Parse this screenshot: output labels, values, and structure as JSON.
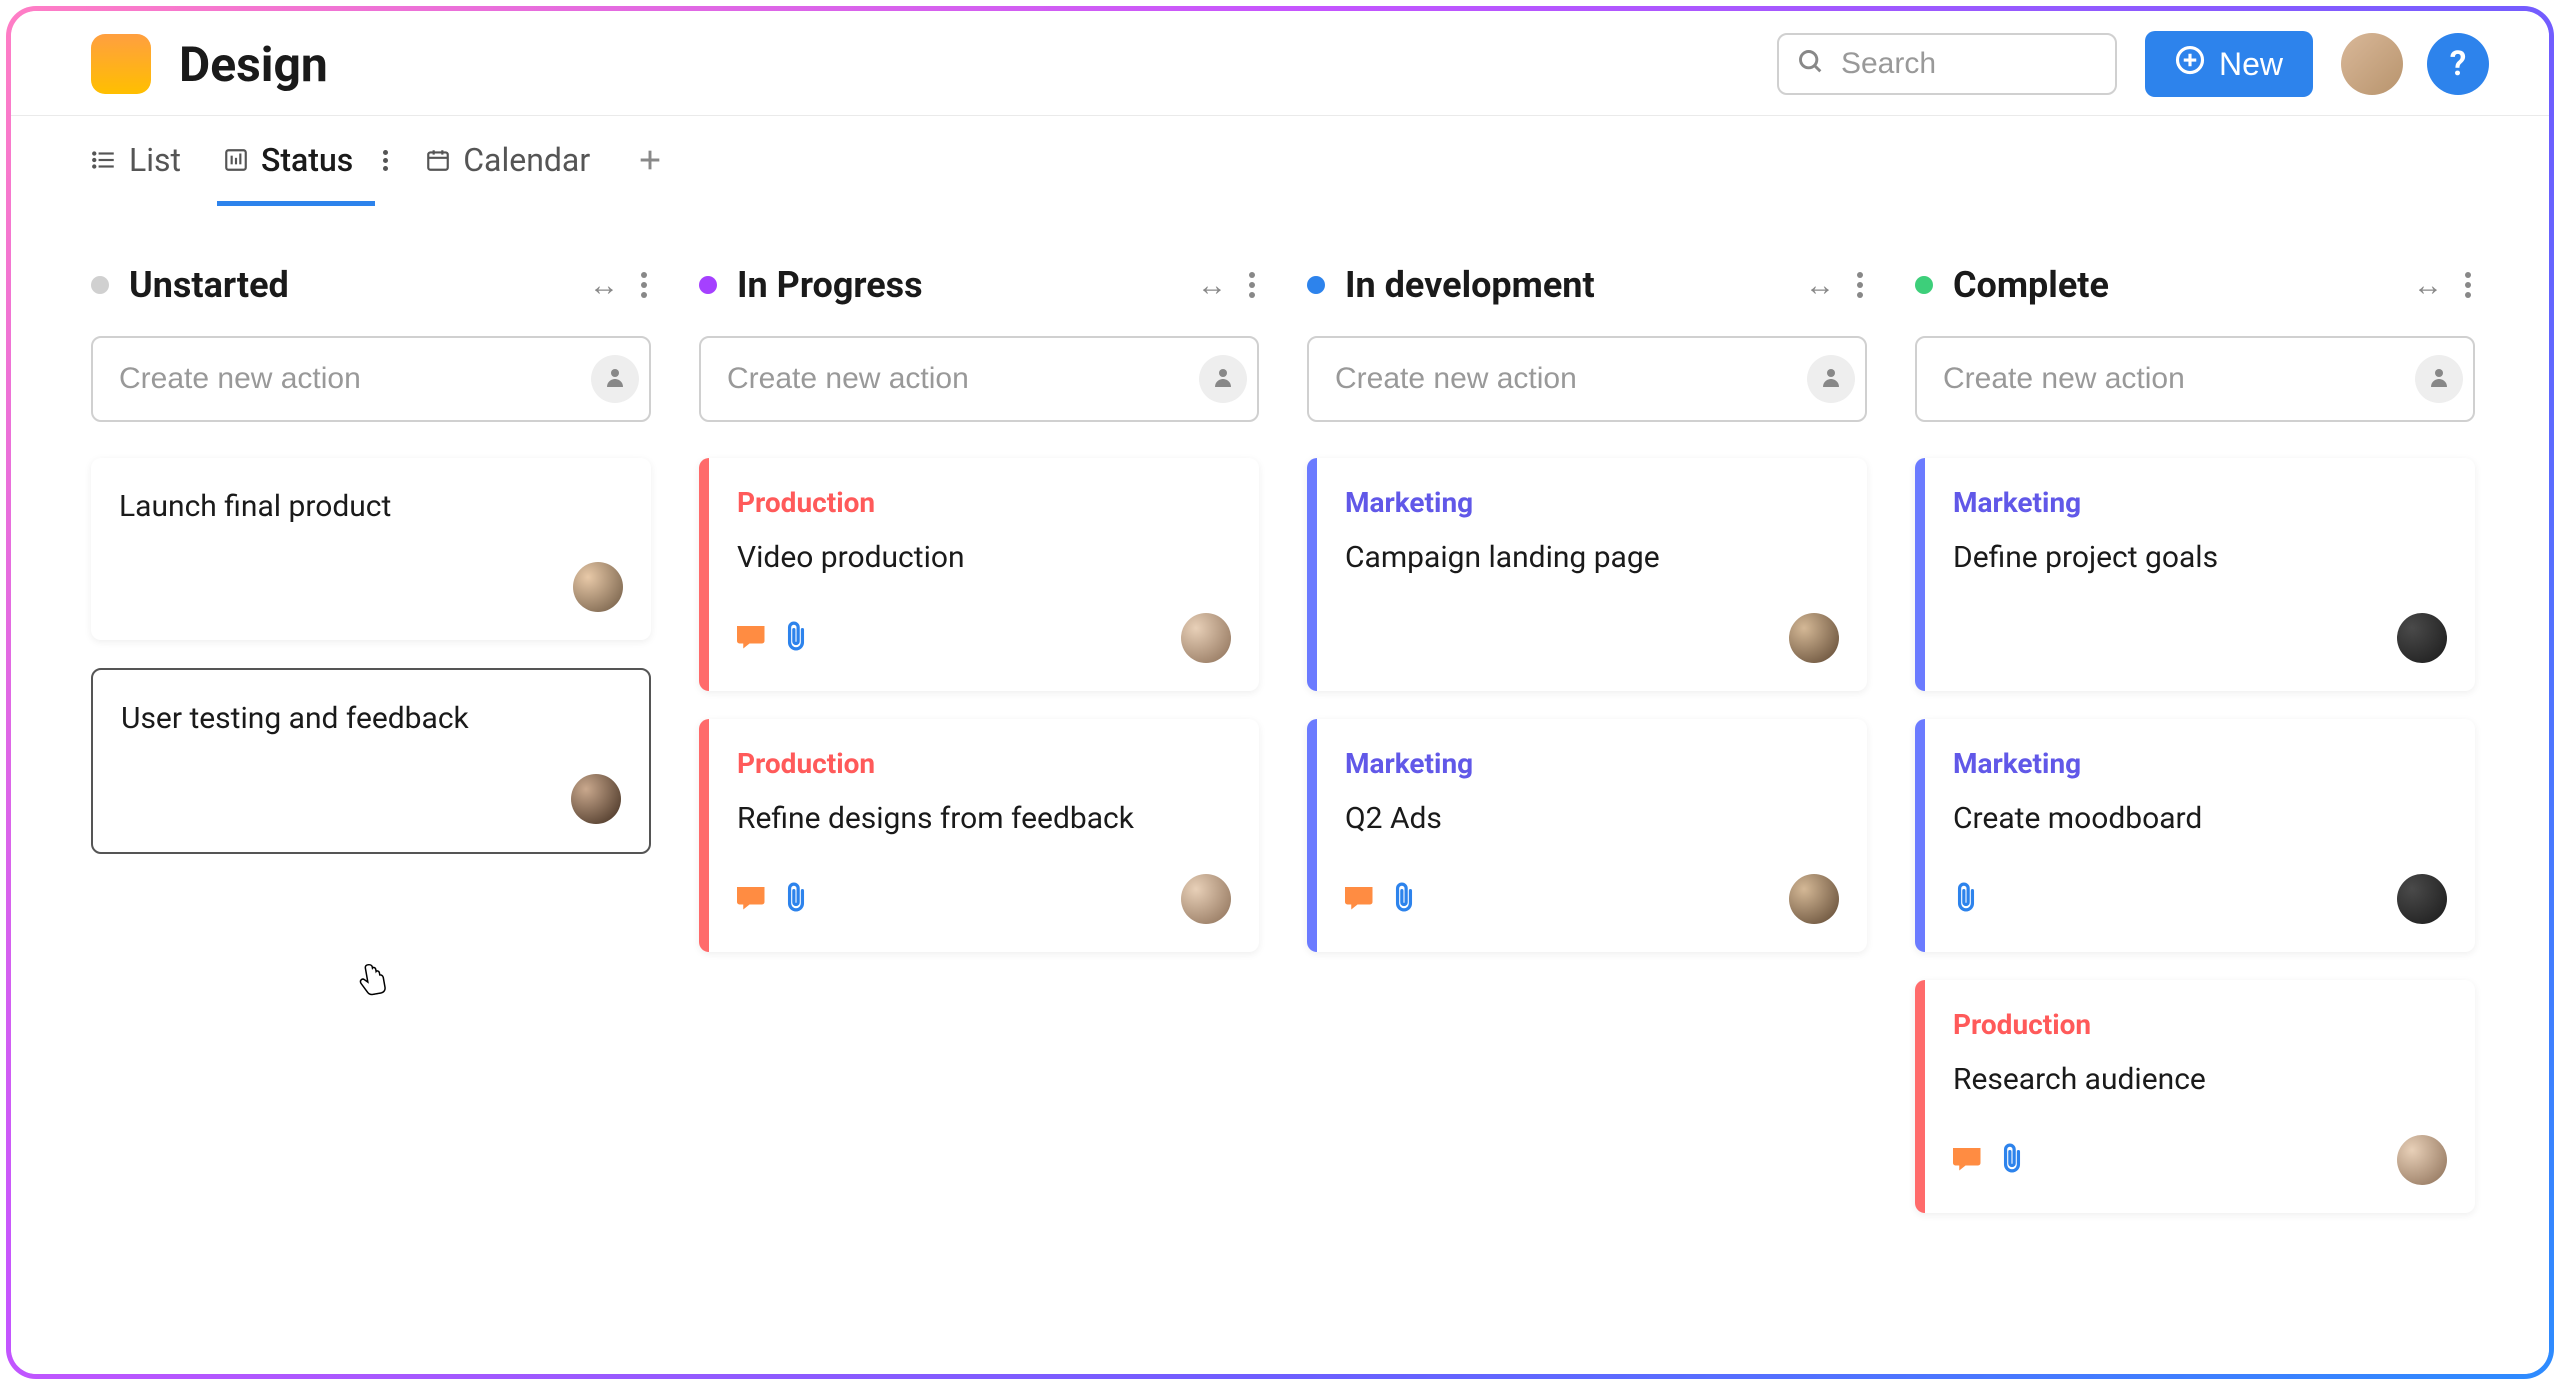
{
  "header": {
    "project_title": "Design",
    "search_placeholder": "Search",
    "new_button": "New",
    "help_label": "?"
  },
  "tabs": {
    "list": "List",
    "status": "Status",
    "calendar": "Calendar"
  },
  "create_placeholder": "Create new action",
  "columns": [
    {
      "id": "unstarted",
      "title": "Unstarted",
      "dot_color": "#d0d0d0",
      "cards": [
        {
          "title": "Launch final product",
          "avatar": "av1"
        },
        {
          "title": "User testing and feedback",
          "avatar": "av2",
          "selected": true
        }
      ]
    },
    {
      "id": "in-progress",
      "title": "In Progress",
      "dot_color": "#a540ff",
      "cards": [
        {
          "category": "Production",
          "cat_class": "cat-red",
          "stripe": "stripe-red",
          "title": "Video production",
          "has_comment": true,
          "has_attach": true,
          "avatar": "av3"
        },
        {
          "category": "Production",
          "cat_class": "cat-red",
          "stripe": "stripe-red",
          "title": "Refine designs from feedback",
          "has_comment": true,
          "has_attach": true,
          "avatar": "av3"
        }
      ]
    },
    {
      "id": "in-development",
      "title": "In development",
      "dot_color": "#2d83ec",
      "cards": [
        {
          "category": "Marketing",
          "cat_class": "cat-blue",
          "stripe": "stripe-blue",
          "title": "Campaign landing page",
          "avatar": "av4"
        },
        {
          "category": "Marketing",
          "cat_class": "cat-blue",
          "stripe": "stripe-blue",
          "title": "Q2 Ads",
          "has_comment": true,
          "has_attach": true,
          "avatar": "av4"
        }
      ]
    },
    {
      "id": "complete",
      "title": "Complete",
      "dot_color": "#3dcf7a",
      "cards": [
        {
          "category": "Marketing",
          "cat_class": "cat-blue",
          "stripe": "stripe-blue",
          "title": "Define project goals",
          "avatar": "av5"
        },
        {
          "category": "Marketing",
          "cat_class": "cat-blue",
          "stripe": "stripe-blue",
          "title": "Create moodboard",
          "has_attach": true,
          "avatar": "av5"
        },
        {
          "category": "Production",
          "cat_class": "cat-red",
          "stripe": "stripe-red",
          "title": "Research audience",
          "has_comment": true,
          "has_attach": true,
          "avatar": "av3"
        }
      ]
    }
  ]
}
